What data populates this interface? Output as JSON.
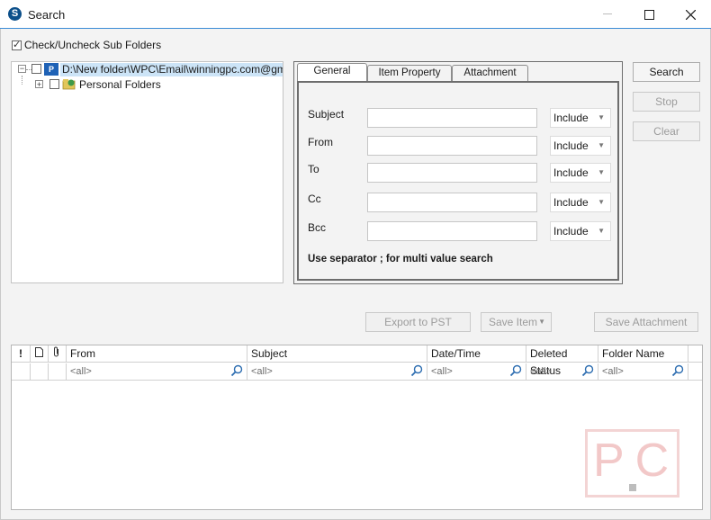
{
  "window": {
    "app_icon_letter": "S",
    "title": "Search"
  },
  "options": {
    "check_uncheck_label": "Check/Uncheck Sub Folders"
  },
  "tree": {
    "root_label": "D:\\New folder\\WPC\\Email\\winningpc.com@gmail.cc",
    "child_label": "Personal Folders",
    "root_badge": "P"
  },
  "tabs": [
    {
      "label": "General"
    },
    {
      "label": "Item Property"
    },
    {
      "label": "Attachment"
    }
  ],
  "form": {
    "fields": [
      {
        "label": "Subject",
        "value": "",
        "mode": "Include"
      },
      {
        "label": "From",
        "value": "",
        "mode": "Include"
      },
      {
        "label": "To",
        "value": "",
        "mode": "Include"
      },
      {
        "label": "Cc",
        "value": "",
        "mode": "Include"
      },
      {
        "label": "Bcc",
        "value": "",
        "mode": "Include"
      }
    ],
    "hint": "Use separator ; for multi value search"
  },
  "actions": {
    "search": "Search",
    "stop": "Stop",
    "clear": "Clear",
    "export_pst": "Export to PST",
    "save_item": "Save Item",
    "save_attachment": "Save Attachment"
  },
  "grid": {
    "icon_columns": [
      "!"
    ],
    "columns": [
      "From",
      "Subject",
      "Date/Time",
      "Deleted Status",
      "Folder Name"
    ],
    "filter_placeholder": "<all>"
  },
  "watermarks": {
    "corner_letters": "PC"
  },
  "colors": {
    "accent": "#3a8bd6",
    "icon_blue": "#0b4f8a"
  }
}
